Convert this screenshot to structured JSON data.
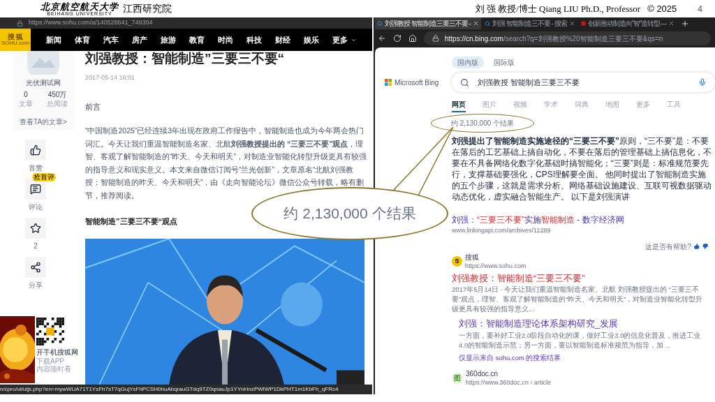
{
  "slide_header": {
    "university_name": "北京航空航天大学",
    "university_name_en": "BEIHANG UNIVERSITY",
    "institute": "江西研究院",
    "author": "刘 强 教授/博士 Qiang LIU Ph.D., Professor",
    "copyright": "© 2025",
    "page_number": "4"
  },
  "sohu_window": {
    "url": "https://www.sohu.com/a/140528641_749304",
    "logo": "搜 狐",
    "logo_sub": "SOHU.com",
    "nav": [
      "新闻",
      "体育",
      "汽车",
      "房产",
      "旅游",
      "教育",
      "时尚",
      "科技",
      "财经",
      "娱乐"
    ],
    "nav_more": "更多",
    "profile": {
      "name": "光伏测试网",
      "stats": [
        {
          "value": "0",
          "label": "文章"
        },
        {
          "value": "450万",
          "label": "总阅读"
        }
      ],
      "link": "查看TA的文章>"
    },
    "actions": [
      {
        "kind": "like",
        "label": "首赞"
      },
      {
        "kind": "comment",
        "label": "评论",
        "badge": "抢首评"
      },
      {
        "kind": "star",
        "label": "2"
      },
      {
        "kind": "share",
        "label": "分享"
      }
    ],
    "app_promo": [
      "开手机搜狐网",
      "下载APP",
      "内容随时看"
    ],
    "article": {
      "title": "刘强教授：智能制造”三要三不要“",
      "date": "2017-05-14 16:01",
      "intro_heading": "前言",
      "paragraph": "“中国制造2025”已经连续3年出现在政府工作报告中，智能制造也成为今年两会热门词汇。今天让我们重温智能制造名家、北航**刘强教授提出的 “三要三不要”观点**，理智、客观了解智能制造的“昨天、今天和明天”，对制造业智能化转型升级更具有较强的指导意义和现实意义。本文来自微信订阅号“兰光创新”，文章原名“北航刘强教授：智能制造的昨天、今天和明天”，由《走向智能论坛》微信公众号转载，略有删节，推荐阅读。",
      "subheading": "智能制造”三要三不要“观点"
    },
    "status_url": "n/cpro/ui/uijs.php?en=mywWUA71T1YsFh7sT7qGujYsFhPCSH0huAbqrauGTdq9TZ0qnauJp1YYnHnzPWlWP1DkPHT1m1KbFh_qFRc4"
  },
  "bing_window": {
    "tabs": [
      {
        "label": "刘强教授 智能制造三要三不要 -",
        "selected": true
      },
      {
        "label": "刘强 智能制造三不要 - 搜索",
        "selected": false
      },
      {
        "label": "创新推动制造向“智”造转型—",
        "selected": false
      }
    ],
    "url_host": "https://cn.bing.com",
    "url_rest": "/search?q=刘强教授%20智能制造三要三不要&qs=n",
    "scopes": [
      {
        "label": "国内版",
        "selected": true
      },
      {
        "label": "国际版",
        "selected": false
      }
    ],
    "brand": "Microsoft Bing",
    "query": "刘强教授 智能制造三要三不要",
    "verticals": [
      {
        "label": "网页",
        "selected": true
      },
      {
        "label": "图片",
        "selected": false
      },
      {
        "label": "视频",
        "selected": false
      },
      {
        "label": "学术",
        "selected": false
      },
      {
        "label": "词典",
        "selected": false
      },
      {
        "label": "地图",
        "selected": false
      },
      {
        "label": "更多",
        "selected": false
      },
      {
        "label": "工具",
        "selected": false
      }
    ],
    "result_count": "约 2,130,000 个结果",
    "answer": "**刘强提出了智能制造实施途径的“三要三不要”**原则，“三不要”是：不要在落后的工艺基础上搞自动化，不要在落后的管理基础上搞信息化，不要在不具备网络化数字化基础时搞智能化；“三要”则是：标准规范要先行，支撑基础要强化，CPS理解要全面。 他同时提出了智能制造实施的五个步骤，这就是需求分析、网络基础设施建设、互联可视数据驱动动态优化，虚实融合智能生产。 以下是刘强演讲",
    "answer_link": {
      "parts": [
        {
          "text": "刘强：",
          "match": false
        },
        {
          "text": "“三要三不要”",
          "match": true
        },
        {
          "text": "实施",
          "match": false
        },
        {
          "text": "智能制造",
          "match": true
        },
        {
          "text": " - 数字经济网",
          "match": false
        }
      ],
      "url": "www.linkingapi.com/archives/11289"
    },
    "feedback": "这是否有帮助?",
    "results": [
      {
        "site": "搜狐",
        "url": "https://www.sohu.com",
        "logo": "S",
        "title": "刘强教授：智能制造“三要三不要”",
        "snippet": "2017年5月14日 · 今天让我们重温智能制造名家、北航 刘强教授提出的 “三要三不要”观点，理智、客观了解智能制造的“昨天、今天和明天”，对制造业智能化转型升级更具有较强的指导意义...",
        "sub_result": {
          "title": "刘强：智能制造理论体系架构研究_发展",
          "snippet": "一方面，要补好工业2.0阶段自动化的课，做好工业3.0的信息化普及，推进工业4.0的智能制造示范；另一方面，要以智能制造标准规范为指导，加 ..."
        },
        "more_link": "仅显示来自 sohu.com 的搜索结果"
      },
      {
        "site": "360doc.cn",
        "url": "https://www.360doc.cn › article",
        "logo": "图"
      }
    ]
  },
  "callout": {
    "text": "约 2,130,000 个结果"
  }
}
